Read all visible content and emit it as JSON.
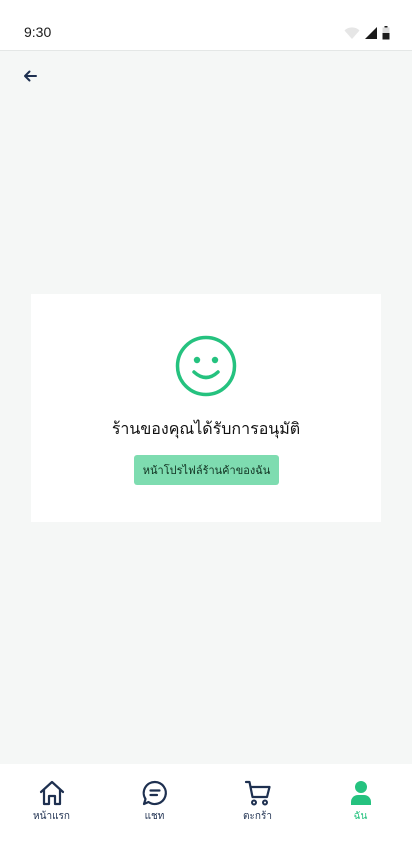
{
  "status_bar": {
    "time": "9:30"
  },
  "header": {
    "back_icon": "arrow-left-icon"
  },
  "card": {
    "icon": "smiley-face-icon",
    "message": "ร้านของคุณได้รับการอนุมัติ",
    "button_label": "หน้าโปรไฟล์ร้านค้าของฉัน"
  },
  "bottom_nav": {
    "items": [
      {
        "label": "หน้าแรก",
        "icon": "home-icon",
        "active": false
      },
      {
        "label": "แชท",
        "icon": "chat-icon",
        "active": false
      },
      {
        "label": "ตะกร้า",
        "icon": "cart-icon",
        "active": false
      },
      {
        "label": "ฉัน",
        "icon": "user-icon",
        "active": true
      }
    ]
  },
  "colors": {
    "accent": "#25c27f",
    "button_bg": "#7edcb0",
    "nav_inactive": "#1e3050",
    "background": "#f5f7f6"
  }
}
